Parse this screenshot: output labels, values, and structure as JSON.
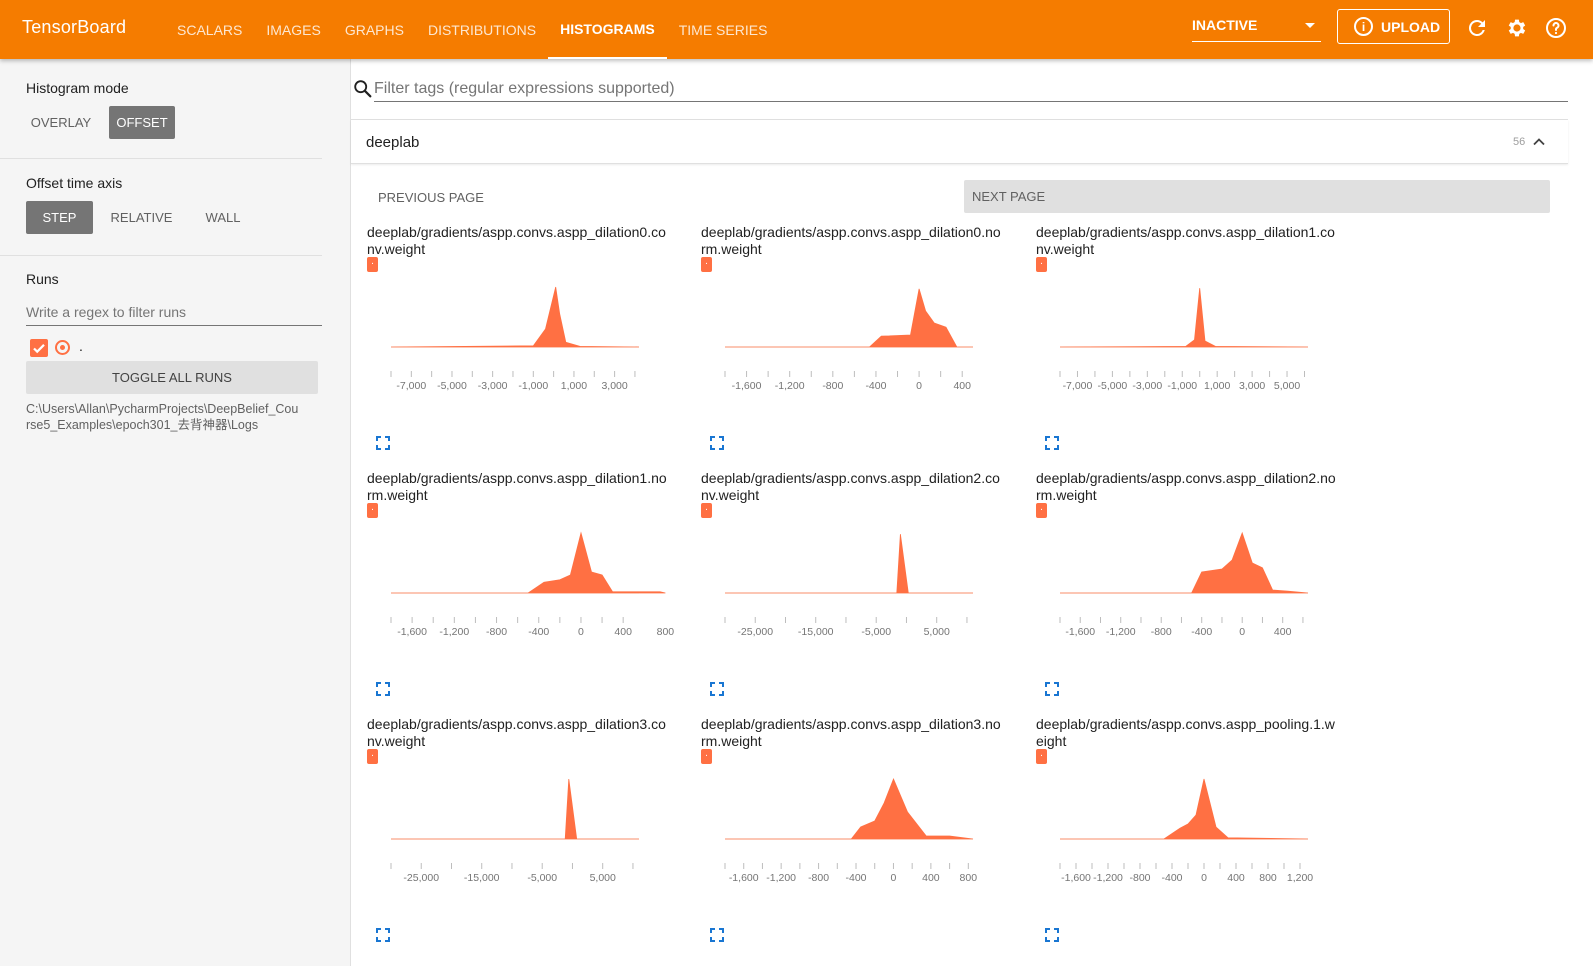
{
  "app": {
    "brand": "TensorBoard",
    "accent_color": "#f57c00",
    "run_color": "#ff7043"
  },
  "nav": {
    "tabs": [
      {
        "label": "SCALARS",
        "active": false
      },
      {
        "label": "IMAGES",
        "active": false
      },
      {
        "label": "GRAPHS",
        "active": false
      },
      {
        "label": "DISTRIBUTIONS",
        "active": false
      },
      {
        "label": "HISTOGRAMS",
        "active": true
      },
      {
        "label": "TIME SERIES",
        "active": false
      }
    ],
    "run_state": "INACTIVE",
    "upload_label": "UPLOAD",
    "icons": [
      "refresh-icon",
      "settings-icon",
      "help-icon"
    ]
  },
  "sidebar": {
    "histogram_mode": {
      "title": "Histogram mode",
      "options": [
        "OVERLAY",
        "OFFSET"
      ],
      "selected": "OFFSET"
    },
    "offset_axis": {
      "title": "Offset time axis",
      "options": [
        "STEP",
        "RELATIVE",
        "WALL"
      ],
      "selected": "STEP"
    },
    "runs": {
      "title": "Runs",
      "filter_placeholder": "Write a regex to filter runs",
      "run_name": ".",
      "run_checked": true,
      "toggle_all_label": "TOGGLE ALL RUNS",
      "logdir": "C:\\Users\\Allan\\PycharmProjects\\DeepBelief_Course5_Examples\\epoch301_去背神器\\Logs"
    }
  },
  "main": {
    "filter_placeholder": "Filter tags (regular expressions supported)",
    "card": {
      "title": "deeplab",
      "count": "56",
      "prev_label": "PREVIOUS PAGE",
      "next_label": "NEXT PAGE"
    }
  },
  "chart_data": [
    {
      "type": "area",
      "title": "deeplab/gradients/aspp.convs.aspp_dilation0.conv.weight",
      "run": ".",
      "xlim": [
        -8000,
        4200
      ],
      "tick_labels": [
        "-7,000",
        "-5,000",
        "-3,000",
        "-1,000",
        "1,000",
        "3,000"
      ],
      "tick_values": [
        -7000,
        -5000,
        -3000,
        -1000,
        1000,
        3000
      ],
      "x": [
        -8000,
        -1000,
        -400,
        100,
        300,
        600,
        1300,
        4200
      ],
      "y": [
        0,
        0.02,
        0.3,
        1.0,
        0.55,
        0.08,
        0.01,
        0
      ]
    },
    {
      "type": "area",
      "title": "deeplab/gradients/aspp.convs.aspp_dilation0.norm.weight",
      "run": ".",
      "xlim": [
        -1800,
        500
      ],
      "tick_labels": [
        "-1,600",
        "-1,200",
        "-800",
        "-400",
        "0",
        "400"
      ],
      "tick_values": [
        -1600,
        -1200,
        -800,
        -400,
        0,
        400
      ],
      "x": [
        -1800,
        -460,
        -350,
        -80,
        0,
        60,
        140,
        250,
        350,
        500
      ],
      "y": [
        0,
        0,
        0.18,
        0.2,
        0.97,
        0.6,
        0.4,
        0.33,
        0.0,
        0
      ]
    },
    {
      "type": "area",
      "title": "deeplab/gradients/aspp.convs.aspp_dilation1.conv.weight",
      "run": ".",
      "xlim": [
        -8000,
        6200
      ],
      "tick_labels": [
        "-7,000",
        "-5,000",
        "-3,000",
        "-1,000",
        "1,000",
        "3,000",
        "5,000"
      ],
      "tick_values": [
        -7000,
        -5000,
        -3000,
        -1000,
        1000,
        3000,
        5000
      ],
      "x": [
        -8000,
        -800,
        -300,
        0,
        300,
        900,
        6200
      ],
      "y": [
        0,
        0.01,
        0.12,
        0.98,
        0.1,
        0.01,
        0
      ]
    },
    {
      "type": "area",
      "title": "deeplab/gradients/aspp.convs.aspp_dilation1.norm.weight",
      "run": ".",
      "xlim": [
        -1800,
        550
      ],
      "tick_labels": [
        "-1,600",
        "-1,200",
        "-800",
        "-400",
        "0",
        "400",
        "800"
      ],
      "tick_values": [
        -1600,
        -1200,
        -800,
        -400,
        0,
        400,
        800
      ],
      "x": [
        -1800,
        -500,
        -350,
        -200,
        -100,
        0,
        100,
        200,
        300,
        750,
        800
      ],
      "y": [
        0,
        0,
        0.18,
        0.22,
        0.3,
        1.0,
        0.35,
        0.3,
        0.02,
        0.02,
        0
      ]
    },
    {
      "type": "area",
      "title": "deeplab/gradients/aspp.convs.aspp_dilation2.conv.weight",
      "run": ".",
      "xlim": [
        -30000,
        11000
      ],
      "tick_labels": [
        "-25,000",
        "-15,000",
        "-5,000",
        "5,000"
      ],
      "tick_values": [
        -25000,
        -15000,
        -5000,
        5000
      ],
      "x": [
        -30000,
        -1600,
        -1000,
        300,
        11000
      ],
      "y": [
        0,
        0,
        0.98,
        0,
        0
      ]
    },
    {
      "type": "area",
      "title": "deeplab/gradients/aspp.convs.aspp_dilation2.norm.weight",
      "run": ".",
      "xlim": [
        -1800,
        650
      ],
      "tick_labels": [
        "-1,600",
        "-1,200",
        "-800",
        "-400",
        "0",
        "400"
      ],
      "tick_values": [
        -1600,
        -1200,
        -800,
        -400,
        0,
        400
      ],
      "x": [
        -1800,
        -500,
        -400,
        -200,
        -100,
        0,
        100,
        200,
        300,
        450,
        650
      ],
      "y": [
        0,
        0,
        0.35,
        0.4,
        0.55,
        1.0,
        0.5,
        0.42,
        0.05,
        0.03,
        0
      ]
    },
    {
      "type": "area",
      "title": "deeplab/gradients/aspp.convs.aspp_dilation3.conv.weight",
      "run": ".",
      "xlim": [
        -30000,
        11000
      ],
      "tick_labels": [
        "-25,000",
        "-15,000",
        "-5,000",
        "5,000"
      ],
      "tick_values": [
        -25000,
        -15000,
        -5000,
        5000
      ],
      "x": [
        -30000,
        -1200,
        -600,
        700,
        11000
      ],
      "y": [
        0,
        0,
        1.0,
        0,
        0
      ]
    },
    {
      "type": "area",
      "title": "deeplab/gradients/aspp.convs.aspp_dilation3.norm.weight",
      "run": ".",
      "xlim": [
        -1800,
        850
      ],
      "tick_labels": [
        "-1,600",
        "-1,200",
        "-800",
        "-400",
        "0",
        "400",
        "800"
      ],
      "tick_values": [
        -1600,
        -1200,
        -800,
        -400,
        0,
        400,
        800
      ],
      "x": [
        -1800,
        -450,
        -350,
        -200,
        -100,
        0,
        150,
        350,
        600,
        850
      ],
      "y": [
        0,
        0,
        0.2,
        0.3,
        0.6,
        1.0,
        0.45,
        0.05,
        0.05,
        0
      ]
    },
    {
      "type": "area",
      "title": "deeplab/gradients/aspp.convs.aspp_pooling.1.weight",
      "run": ".",
      "xlim": [
        -1800,
        1300
      ],
      "tick_labels": [
        "-1,600",
        "-1,200",
        "-800",
        "-400",
        "0",
        "400",
        "800",
        "1,200"
      ],
      "tick_values": [
        -1600,
        -1200,
        -800,
        -400,
        0,
        400,
        800,
        1200
      ],
      "x": [
        -1800,
        -500,
        -300,
        -200,
        -100,
        0,
        150,
        300,
        1300
      ],
      "y": [
        0,
        0,
        0.18,
        0.25,
        0.4,
        1.0,
        0.2,
        0.02,
        0
      ]
    }
  ]
}
